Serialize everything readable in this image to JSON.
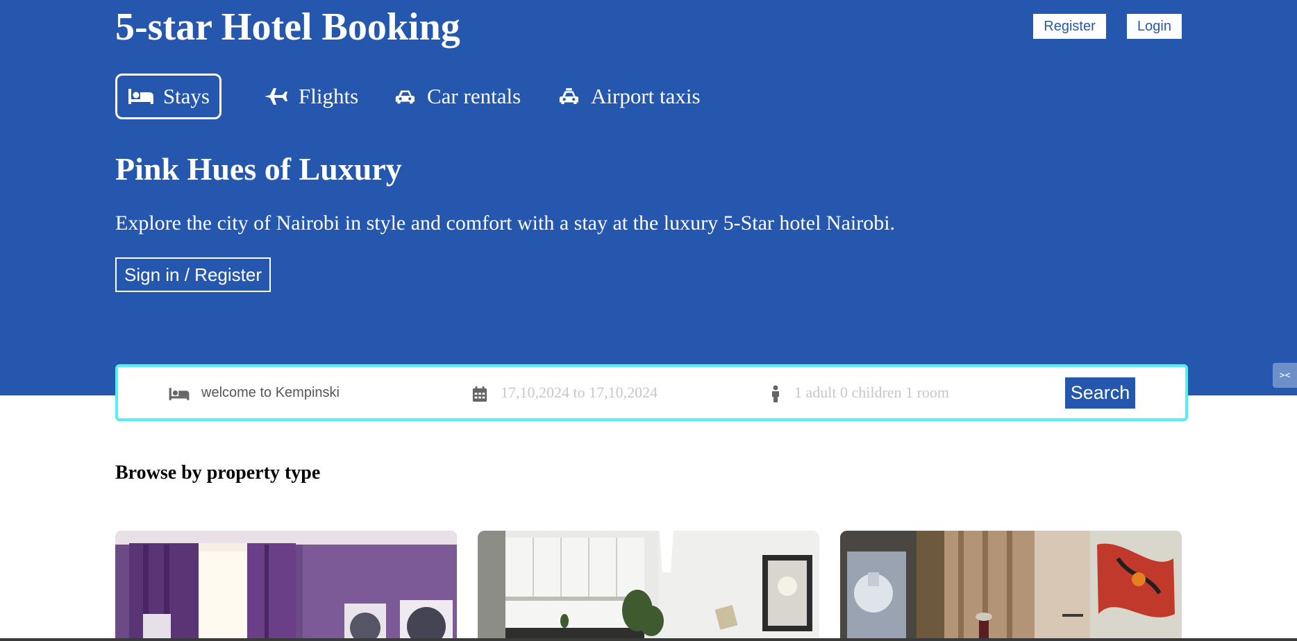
{
  "header": {
    "brand": "5-star Hotel Booking",
    "register_label": "Register",
    "login_label": "Login"
  },
  "nav": {
    "items": [
      {
        "label": "Stays",
        "icon": "bed-icon",
        "active": true
      },
      {
        "label": "Flights",
        "icon": "plane-icon",
        "active": false
      },
      {
        "label": "Car rentals",
        "icon": "car-icon",
        "active": false
      },
      {
        "label": "Airport taxis",
        "icon": "taxi-icon",
        "active": false
      }
    ]
  },
  "hero": {
    "title": "Pink Hues of Luxury",
    "description": "Explore the city of Nairobi in style and comfort with a stay at the luxury 5-Star hotel Nairobi.",
    "signin_label": "Sign in / Register"
  },
  "search": {
    "destination_value": "welcome to Kempinski",
    "dates": "17,10,2024 to 17,10,2024",
    "guests": "1 adult 0 children 1 room",
    "button_label": "Search"
  },
  "browse": {
    "title": "Browse by property type",
    "cards": [
      {
        "icon": "purple-hotel-room-photo"
      },
      {
        "icon": "white-apartment-kitchen-photo"
      },
      {
        "icon": "villa-living-room-photo"
      }
    ]
  },
  "colors": {
    "brand_blue": "#2457ad",
    "search_border": "#4ff0f8",
    "white": "#ffffff"
  }
}
